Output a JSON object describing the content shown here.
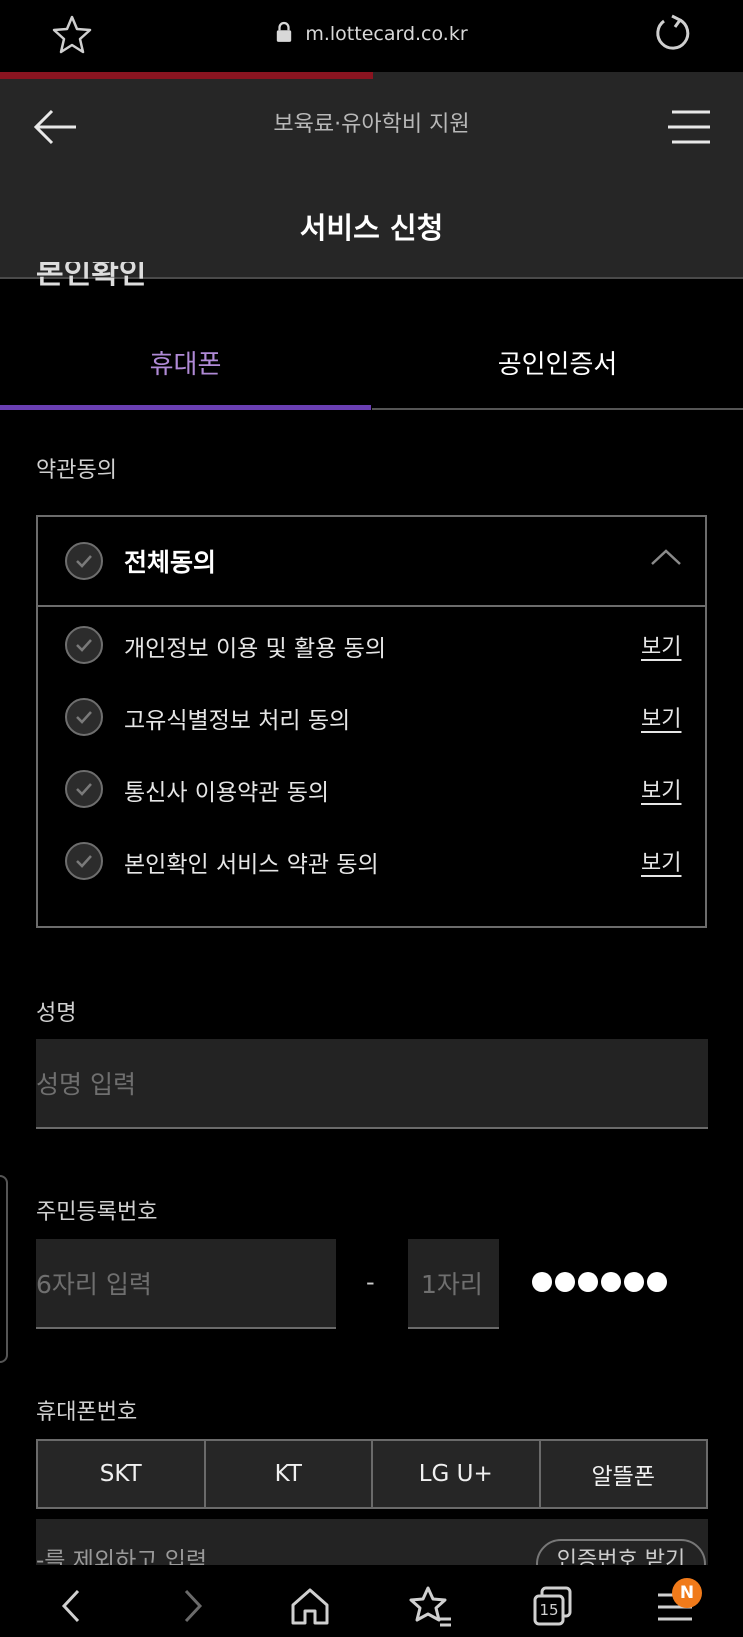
{
  "browser": {
    "url": "m.lottecard.co.kr"
  },
  "header": {
    "subtitle": "보육료·유아학비 지원",
    "title": "서비스 신청",
    "cut_heading": "본인확인"
  },
  "tabs": [
    {
      "label": "휴대폰",
      "active": true
    },
    {
      "label": "공인인증서",
      "active": false
    }
  ],
  "terms": {
    "section_label": "약관동의",
    "all_label": "전체동의",
    "items": [
      {
        "label": "개인정보 이용 및 활용 동의",
        "link": "보기"
      },
      {
        "label": "고유식별정보 처리 동의",
        "link": "보기"
      },
      {
        "label": "통신사 이용약관 동의",
        "link": "보기"
      },
      {
        "label": "본인확인 서비스 약관 동의",
        "link": "보기"
      }
    ]
  },
  "name": {
    "label": "성명",
    "placeholder": "성명 입력"
  },
  "rrn": {
    "label": "주민등록번호",
    "front_placeholder": "6자리 입력",
    "separator": "-",
    "back_placeholder": "1자리",
    "masked_count": 6
  },
  "phone": {
    "label": "휴대폰번호",
    "carriers": [
      "SKT",
      "KT",
      "LG U+",
      "알뜰폰"
    ],
    "partial_placeholder": "-를 제외하고 입력",
    "verify_button": "인증번호 받기"
  },
  "bottom_nav": {
    "tab_count": "15",
    "badge": "N"
  },
  "colors": {
    "accent": "#6a3fb3",
    "accent_text": "#b08ad6",
    "progress": "#8a1420",
    "badge": "#f07a1a"
  }
}
